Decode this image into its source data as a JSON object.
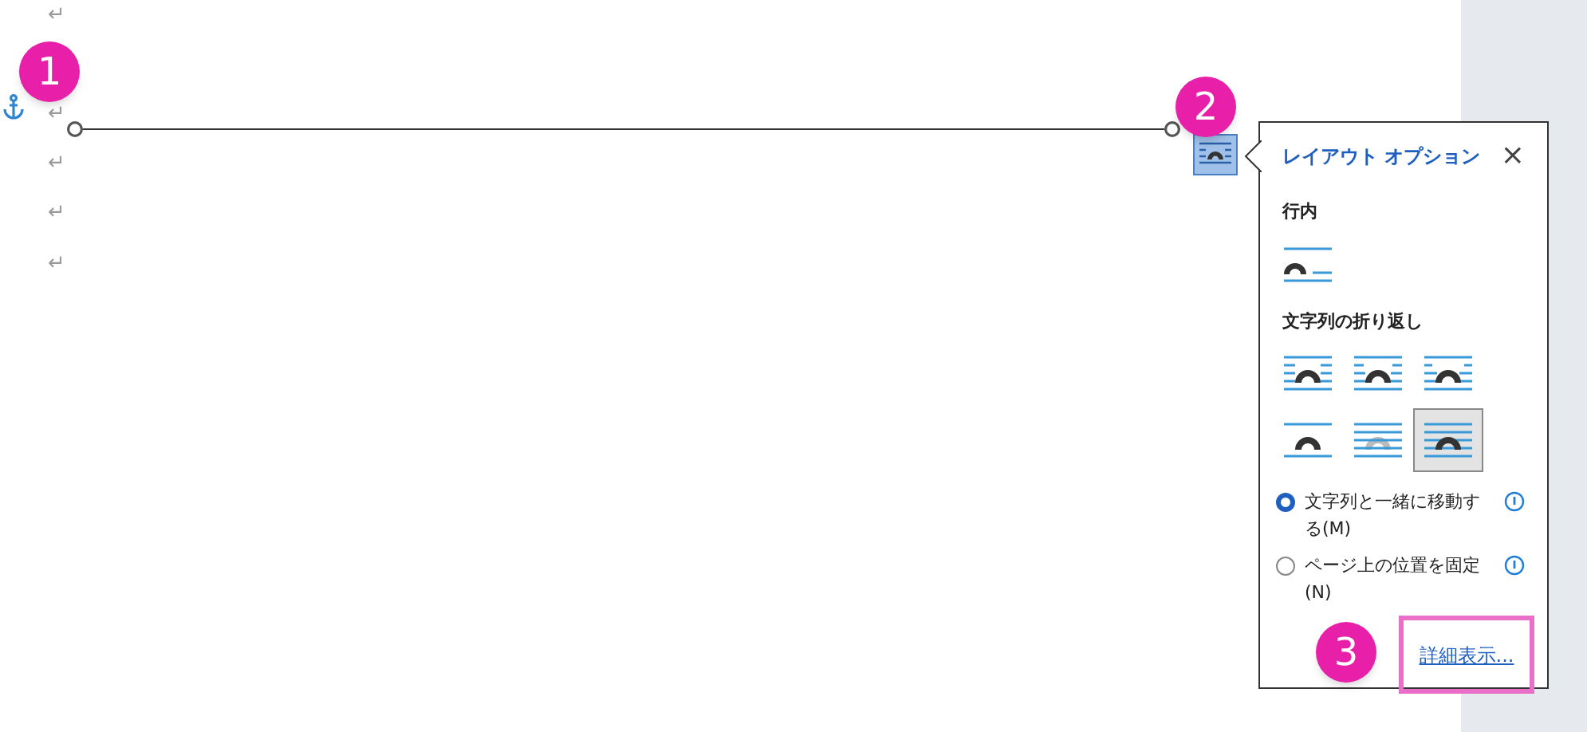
{
  "paragraph_marks": [
    "↵",
    "↵",
    "↵",
    "↵",
    "↵"
  ],
  "callouts": [
    "1",
    "2",
    "3"
  ],
  "layout_options": {
    "title": "レイアウト オプション",
    "close": "×",
    "inline_heading": "行内",
    "inline_options": [
      {
        "kind": "inline",
        "selected": false
      }
    ],
    "wrap_heading": "文字列の折り返し",
    "wrap_options": [
      {
        "kind": "square",
        "selected": false
      },
      {
        "kind": "tight",
        "selected": false
      },
      {
        "kind": "through",
        "selected": false
      },
      {
        "kind": "topbottom",
        "selected": false
      },
      {
        "kind": "behind",
        "selected": false
      },
      {
        "kind": "front",
        "selected": true
      }
    ],
    "position_options": [
      {
        "label": "文字列と一緒に移動する(M)",
        "selected": true
      },
      {
        "label": "ページ上の位置を固定(N)",
        "selected": false
      }
    ],
    "more_link": "詳細表示..."
  }
}
